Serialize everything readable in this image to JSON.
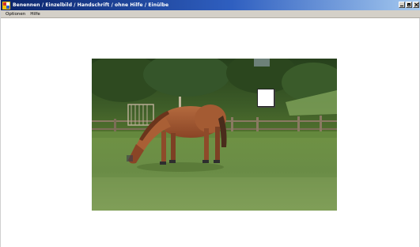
{
  "window": {
    "title": "Benennen / Einzelbild / Handschrift / ohne Hilfe / Einülbe"
  },
  "menu": {
    "items": [
      "Optionen",
      "Hilfe"
    ]
  },
  "colors": {
    "titlebar_start": "#0a246a",
    "titlebar_end": "#a6caf0",
    "menubar": "#d4d0c8",
    "background": "#ffffff"
  },
  "image": {
    "subject": "horse grazing in a fenced meadow"
  }
}
